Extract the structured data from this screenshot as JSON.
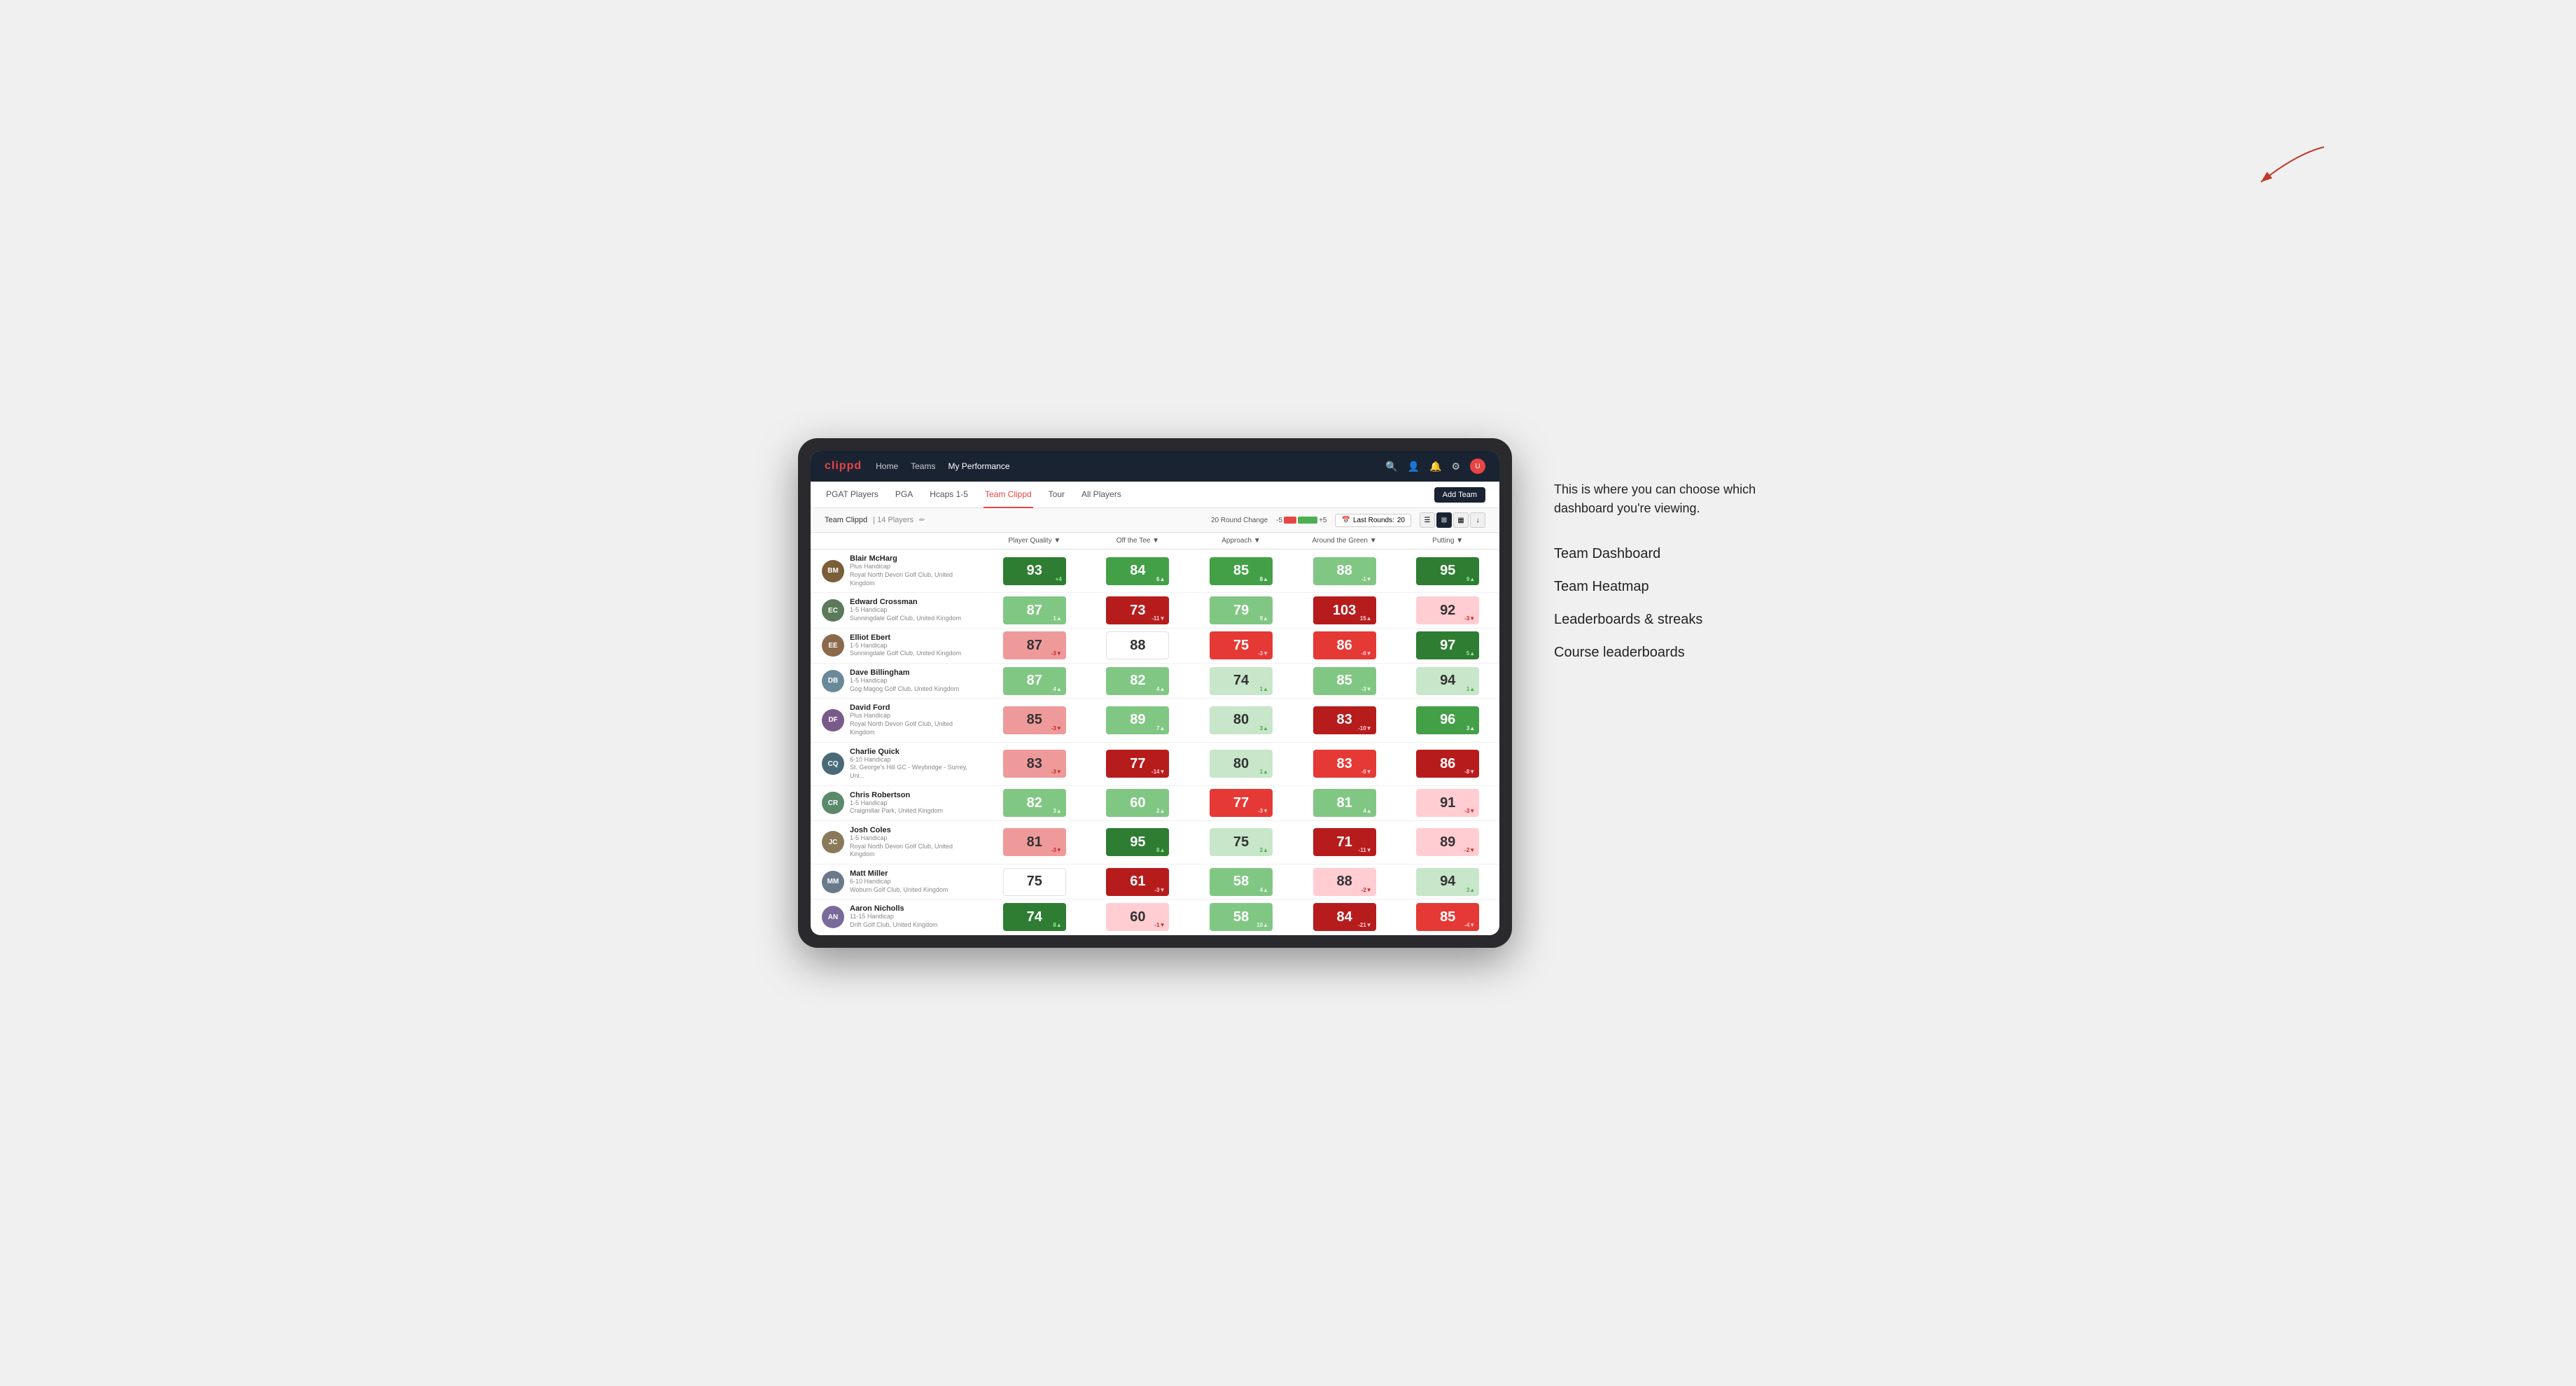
{
  "annotation": {
    "intro_text": "This is where you can choose which dashboard you're viewing.",
    "items": [
      {
        "label": "Team Dashboard"
      },
      {
        "label": "Team Heatmap"
      },
      {
        "label": "Leaderboards & streaks"
      },
      {
        "label": "Course leaderboards"
      }
    ]
  },
  "nav": {
    "logo": "clippd",
    "links": [
      {
        "label": "Home",
        "active": false
      },
      {
        "label": "Teams",
        "active": false
      },
      {
        "label": "My Performance",
        "active": true
      }
    ],
    "icons": [
      "search",
      "user",
      "bell",
      "settings",
      "avatar"
    ]
  },
  "sub_nav": {
    "links": [
      {
        "label": "PGAT Players",
        "active": false
      },
      {
        "label": "PGA",
        "active": false
      },
      {
        "label": "Hcaps 1-5",
        "active": false
      },
      {
        "label": "Team Clippd",
        "active": true
      },
      {
        "label": "Tour",
        "active": false
      },
      {
        "label": "All Players",
        "active": false
      }
    ],
    "add_team_label": "Add Team"
  },
  "team_header": {
    "name": "Team Clippd",
    "player_count": "14 Players",
    "round_change_label": "20 Round Change",
    "round_change_neg": "-5",
    "round_change_pos": "+5",
    "last_rounds_label": "Last Rounds:",
    "last_rounds_value": "20"
  },
  "table": {
    "columns": [
      {
        "label": "Player Quality ▼",
        "key": "player_quality"
      },
      {
        "label": "Off the Tee ▼",
        "key": "off_tee"
      },
      {
        "label": "Approach ▼",
        "key": "approach"
      },
      {
        "label": "Around the Green ▼",
        "key": "around_green"
      },
      {
        "label": "Putting ▼",
        "key": "putting"
      }
    ],
    "rows": [
      {
        "name": "Blair McHarg",
        "handicap": "Plus Handicap",
        "club": "Royal North Devon Golf Club, United Kingdom",
        "initials": "BM",
        "avatar_color": "#7b5e3a",
        "player_quality": {
          "value": "93",
          "change": "+4",
          "dir": "up",
          "color": "dark-green"
        },
        "off_tee": {
          "value": "84",
          "change": "6▲",
          "dir": "up",
          "color": "green"
        },
        "approach": {
          "value": "85",
          "change": "8▲",
          "dir": "up",
          "color": "green"
        },
        "around_green": {
          "value": "88",
          "change": "-1▼",
          "dir": "down",
          "color": "light-green"
        },
        "putting": {
          "value": "95",
          "change": "9▲",
          "dir": "up",
          "color": "dark-green"
        }
      },
      {
        "name": "Edward Crossman",
        "handicap": "1-5 Handicap",
        "club": "Sunningdale Golf Club, United Kingdom",
        "initials": "EC",
        "avatar_color": "#5a7a5a",
        "player_quality": {
          "value": "87",
          "change": "1▲",
          "dir": "up",
          "color": "light-green"
        },
        "off_tee": {
          "value": "73",
          "change": "-11▼",
          "dir": "down",
          "color": "dark-red"
        },
        "approach": {
          "value": "79",
          "change": "9▲",
          "dir": "up",
          "color": "light-green"
        },
        "around_green": {
          "value": "103",
          "change": "15▲",
          "dir": "up",
          "color": "dark-red"
        },
        "putting": {
          "value": "92",
          "change": "-3▼",
          "dir": "down",
          "color": "very-light-red"
        }
      },
      {
        "name": "Elliot Ebert",
        "handicap": "1-5 Handicap",
        "club": "Sunningdale Golf Club, United Kingdom",
        "initials": "EE",
        "avatar_color": "#8a6a4a",
        "player_quality": {
          "value": "87",
          "change": "-3▼",
          "dir": "down",
          "color": "light-red"
        },
        "off_tee": {
          "value": "88",
          "change": "",
          "dir": "none",
          "color": "white"
        },
        "approach": {
          "value": "75",
          "change": "-3▼",
          "dir": "down",
          "color": "red"
        },
        "around_green": {
          "value": "86",
          "change": "-6▼",
          "dir": "down",
          "color": "red"
        },
        "putting": {
          "value": "97",
          "change": "5▲",
          "dir": "up",
          "color": "dark-green"
        }
      },
      {
        "name": "Dave Billingham",
        "handicap": "1-5 Handicap",
        "club": "Gog Magog Golf Club, United Kingdom",
        "initials": "DB",
        "avatar_color": "#6a8a9a",
        "player_quality": {
          "value": "87",
          "change": "4▲",
          "dir": "up",
          "color": "light-green"
        },
        "off_tee": {
          "value": "82",
          "change": "4▲",
          "dir": "up",
          "color": "light-green"
        },
        "approach": {
          "value": "74",
          "change": "1▲",
          "dir": "up",
          "color": "very-light-green"
        },
        "around_green": {
          "value": "85",
          "change": "-3▼",
          "dir": "down",
          "color": "light-green"
        },
        "putting": {
          "value": "94",
          "change": "1▲",
          "dir": "up",
          "color": "very-light-green"
        }
      },
      {
        "name": "David Ford",
        "handicap": "Plus Handicap",
        "club": "Royal North Devon Golf Club, United Kingdom",
        "initials": "DF",
        "avatar_color": "#7a5a8a",
        "player_quality": {
          "value": "85",
          "change": "-3▼",
          "dir": "down",
          "color": "light-red"
        },
        "off_tee": {
          "value": "89",
          "change": "7▲",
          "dir": "up",
          "color": "light-green"
        },
        "approach": {
          "value": "80",
          "change": "3▲",
          "dir": "up",
          "color": "very-light-green"
        },
        "around_green": {
          "value": "83",
          "change": "-10▼",
          "dir": "down",
          "color": "dark-red"
        },
        "putting": {
          "value": "96",
          "change": "3▲",
          "dir": "up",
          "color": "green"
        }
      },
      {
        "name": "Charlie Quick",
        "handicap": "6-10 Handicap",
        "club": "St. George's Hill GC - Weybridge - Surrey, Uni...",
        "initials": "CQ",
        "avatar_color": "#4a6a7a",
        "player_quality": {
          "value": "83",
          "change": "-3▼",
          "dir": "down",
          "color": "light-red"
        },
        "off_tee": {
          "value": "77",
          "change": "-14▼",
          "dir": "down",
          "color": "dark-red"
        },
        "approach": {
          "value": "80",
          "change": "1▲",
          "dir": "up",
          "color": "very-light-green"
        },
        "around_green": {
          "value": "83",
          "change": "-6▼",
          "dir": "down",
          "color": "red"
        },
        "putting": {
          "value": "86",
          "change": "-8▼",
          "dir": "down",
          "color": "dark-red"
        }
      },
      {
        "name": "Chris Robertson",
        "handicap": "1-5 Handicap",
        "club": "Craigmillar Park, United Kingdom",
        "initials": "CR",
        "avatar_color": "#5a8a6a",
        "player_quality": {
          "value": "82",
          "change": "3▲",
          "dir": "up",
          "color": "light-green"
        },
        "off_tee": {
          "value": "60",
          "change": "2▲",
          "dir": "up",
          "color": "light-green"
        },
        "approach": {
          "value": "77",
          "change": "-3▼",
          "dir": "down",
          "color": "red"
        },
        "around_green": {
          "value": "81",
          "change": "4▲",
          "dir": "up",
          "color": "light-green"
        },
        "putting": {
          "value": "91",
          "change": "-3▼",
          "dir": "down",
          "color": "very-light-red"
        }
      },
      {
        "name": "Josh Coles",
        "handicap": "1-5 Handicap",
        "club": "Royal North Devon Golf Club, United Kingdom",
        "initials": "JC",
        "avatar_color": "#8a7a5a",
        "player_quality": {
          "value": "81",
          "change": "-3▼",
          "dir": "down",
          "color": "light-red"
        },
        "off_tee": {
          "value": "95",
          "change": "8▲",
          "dir": "up",
          "color": "dark-green"
        },
        "approach": {
          "value": "75",
          "change": "2▲",
          "dir": "up",
          "color": "very-light-green"
        },
        "around_green": {
          "value": "71",
          "change": "-11▼",
          "dir": "down",
          "color": "dark-red"
        },
        "putting": {
          "value": "89",
          "change": "-2▼",
          "dir": "down",
          "color": "very-light-red"
        }
      },
      {
        "name": "Matt Miller",
        "handicap": "6-10 Handicap",
        "club": "Woburn Golf Club, United Kingdom",
        "initials": "MM",
        "avatar_color": "#6a7a8a",
        "player_quality": {
          "value": "75",
          "change": "",
          "dir": "none",
          "color": "white"
        },
        "off_tee": {
          "value": "61",
          "change": "-3▼",
          "dir": "down",
          "color": "dark-red"
        },
        "approach": {
          "value": "58",
          "change": "4▲",
          "dir": "up",
          "color": "light-green"
        },
        "around_green": {
          "value": "88",
          "change": "-2▼",
          "dir": "down",
          "color": "very-light-red"
        },
        "putting": {
          "value": "94",
          "change": "3▲",
          "dir": "up",
          "color": "very-light-green"
        }
      },
      {
        "name": "Aaron Nicholls",
        "handicap": "11-15 Handicap",
        "club": "Drift Golf Club, United Kingdom",
        "initials": "AN",
        "avatar_color": "#7a6a9a",
        "player_quality": {
          "value": "74",
          "change": "8▲",
          "dir": "up",
          "color": "dark-green"
        },
        "off_tee": {
          "value": "60",
          "change": "-1▼",
          "dir": "down",
          "color": "very-light-red"
        },
        "approach": {
          "value": "58",
          "change": "10▲",
          "dir": "up",
          "color": "light-green"
        },
        "around_green": {
          "value": "84",
          "change": "-21▼",
          "dir": "down",
          "color": "dark-red"
        },
        "putting": {
          "value": "85",
          "change": "-4▼",
          "dir": "down",
          "color": "red"
        }
      }
    ]
  },
  "colors": {
    "dark_green": "#2e7d32",
    "green": "#43a047",
    "light_green": "#81c784",
    "very_light_green": "#c8e6c9",
    "white": "#ffffff",
    "very_light_red": "#ffcdd2",
    "light_red": "#ef9a9a",
    "red": "#e53935",
    "dark_red": "#b71c1c",
    "nav_bg": "#1a2332",
    "brand_red": "#e84545"
  }
}
